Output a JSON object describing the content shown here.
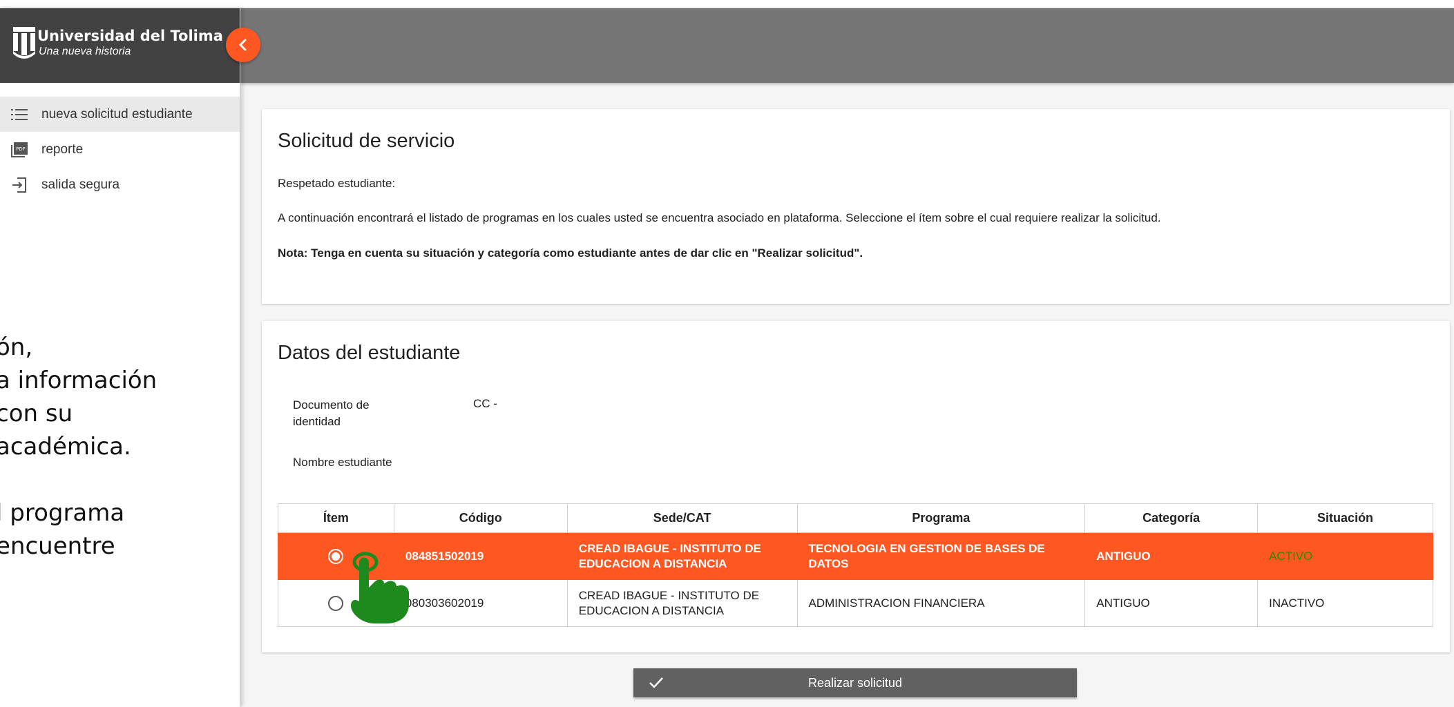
{
  "brand": {
    "title": "Universidad del Tolima",
    "subtitle": "Una nueva historia"
  },
  "sidebar": {
    "items": [
      {
        "label": "nueva solicitud estudiante",
        "icon": "list-icon",
        "active": true
      },
      {
        "label": "reporte",
        "icon": "pdf-icon",
        "active": false
      },
      {
        "label": "salida segura",
        "icon": "logout-icon",
        "active": false
      }
    ]
  },
  "tutorial_text": "ón,\na información\ncon su\nacadémica.\n\nl programa\nencuentre",
  "service_card": {
    "title": "Solicitud de servicio",
    "greeting": "Respetado estudiante:",
    "instructions": "A continuación encontrará el listado de programas en los cuales usted se encuentra asociado en plataforma. Seleccione el ítem sobre el cual requiere realizar la solicitud.",
    "note": "Nota: Tenga en cuenta su situación y categoría como estudiante antes de dar clic en \"Realizar solicitud\"."
  },
  "student_card": {
    "title": "Datos del estudiante",
    "document_label": "Documento de identidad",
    "document_value": "CC -",
    "name_label": "Nombre estudiante",
    "name_value": ""
  },
  "table": {
    "headers": [
      "Ítem",
      "Código",
      "Sede/CAT",
      "Programa",
      "Categoría",
      "Situación"
    ],
    "rows": [
      {
        "selected": true,
        "codigo": "084851502019",
        "sede": "CREAD IBAGUE - INSTITUTO DE EDUCACION A DISTANCIA",
        "programa": "TECNOLOGIA EN GESTION DE BASES DE DATOS",
        "categoria": "ANTIGUO",
        "situacion": "ACTIVO"
      },
      {
        "selected": false,
        "codigo": "080303602019",
        "sede": "CREAD IBAGUE - INSTITUTO DE EDUCACION A DISTANCIA",
        "programa": "ADMINISTRACION FINANCIERA",
        "categoria": "ANTIGUO",
        "situacion": "INACTIVO"
      }
    ]
  },
  "submit_label": "Realizar solicitud",
  "colors": {
    "accent": "#ff5722",
    "header": "#757575",
    "brand_bg": "#424242",
    "active_status": "#2e8b00",
    "pointer": "#1e8a1e"
  }
}
